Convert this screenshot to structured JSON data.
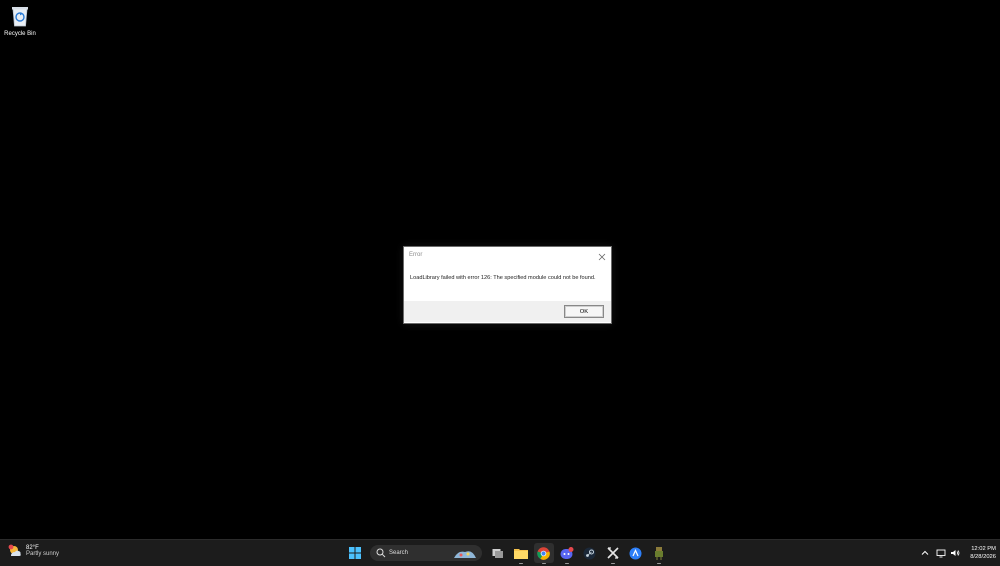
{
  "desktop": {
    "recycle_bin_label": "Recycle Bin"
  },
  "dialog": {
    "title": "Error",
    "message": "LoadLibrary failed with error 126: The specified module could not be found.",
    "ok_label": "OK"
  },
  "taskbar": {
    "weather": {
      "temp": "82°F",
      "desc": "Partly sunny",
      "badge": "1"
    },
    "search_label": "Search",
    "discord_badge": "3",
    "apps": [
      "start-icon",
      "search",
      "task-view-icon",
      "file-explorer-icon",
      "chrome-icon",
      "discord-icon",
      "steam-icon",
      "xbox-app-icon",
      "app-icon",
      "game-icon"
    ],
    "tray": {
      "time": "12:02 PM",
      "date": "8/28/2026"
    }
  },
  "colors": {
    "taskbar_bg": "#1c1c1c",
    "desktop_bg": "#000000",
    "dialog_footer": "#f0f0f0"
  }
}
